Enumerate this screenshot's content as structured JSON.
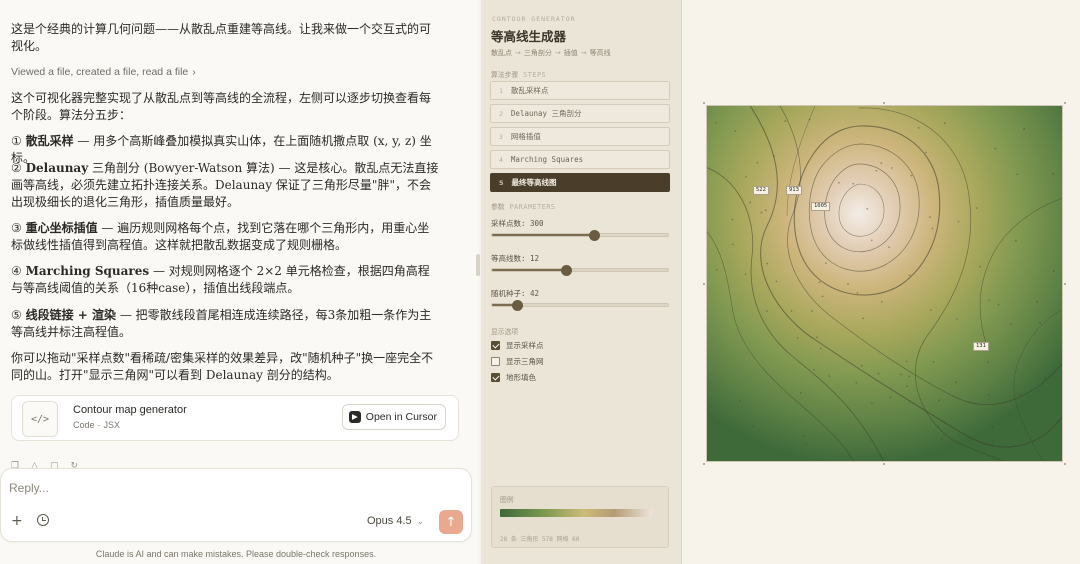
{
  "chat": {
    "intro": "这是个经典的计算几何问题——从散乱点重建等高线。让我来做一个交互式的可视化。",
    "tool_line": "Viewed a file, created a file, read a file",
    "summary": "这个可视化器完整实现了从散乱点到等高线的全流程，左侧可以逐步切换查看每个阶段。算法分五步：",
    "steps": [
      {
        "marker": "①",
        "title": "散乱采样",
        "sep": " — ",
        "body": "用多个高斯峰叠加模拟真实山体，在上面随机撒点取 (x, y, z) 坐标。"
      },
      {
        "marker": "②",
        "title": "Delaunay",
        "title_tail": " 三角剖分 (Bowyer-Watson 算法)",
        "sep": " — ",
        "body": "这是核心。散乱点无法直接画等高线，必须先建立拓扑连接关系。Delaunay 保证了三角形尽量\"胖\"，不会出现极细长的退化三角形，插值质量最好。"
      },
      {
        "marker": "③",
        "title": "重心坐标插值",
        "sep": " — ",
        "body": "遍历规则网格每个点，找到它落在哪个三角形内，用重心坐标做线性插值得到高程值。这样就把散乱数据变成了规则栅格。"
      },
      {
        "marker": "④",
        "title": "Marching Squares",
        "sep": " — ",
        "body": "对规则网格逐个 2×2 单元格检查，根据四角高程与等高线阈值的关系（16种case），插值出线段端点。"
      },
      {
        "marker": "⑤",
        "title": "线段链接 + 渲染",
        "sep": " — ",
        "body": "把零散线段首尾相连成连续路径，每3条加粗一条作为主等高线并标注高程值。"
      }
    ],
    "closing": "你可以拖动\"采样点数\"看稀疏/密集采样的效果差异，改\"随机种子\"换一座完全不同的山。打开\"显示三角网\"可以看到 Delaunay 剖分的结构。",
    "artifact": {
      "title": "Contour map generator",
      "type": "Code",
      "lang": "JSX",
      "open_label": "Open in Cursor"
    },
    "composer": {
      "placeholder": "Reply...",
      "model": "Opus 4.5"
    },
    "disclaimer": "Claude is AI and can make mistakes. Please double-check responses."
  },
  "sidebar": {
    "subtitle": "CONTOUR GENERATOR",
    "title": "等高线生成器",
    "breadcrumb": [
      "散乱点",
      "三角剖分",
      "插值",
      "等高线"
    ],
    "steps_section": {
      "label": "算法步骤",
      "label_en": "STEPS"
    },
    "steps": [
      {
        "num": "1",
        "label": "散乱采样点"
      },
      {
        "num": "2",
        "label": "Delaunay 三角剖分"
      },
      {
        "num": "3",
        "label": "网格插值"
      },
      {
        "num": "4",
        "label": "Marching Squares"
      },
      {
        "num": "5",
        "label": "最终等高线图",
        "active": true
      }
    ],
    "params_section": {
      "label": "参数",
      "label_en": "PARAMETERS"
    },
    "sliders": [
      {
        "label": "采样点数",
        "value": "300",
        "fraction": 0.58
      },
      {
        "label": "等高线数",
        "value": "12",
        "fraction": 0.42
      },
      {
        "label": "随机种子",
        "value": "42",
        "fraction": 0.14
      }
    ],
    "display_section": {
      "label": "显示选项"
    },
    "checks": [
      {
        "label": "显示采样点",
        "checked": true
      },
      {
        "label": "显示三角网",
        "checked": false
      },
      {
        "label": "地形填色",
        "checked": true
      }
    ],
    "legend": {
      "title": "图例",
      "stats": "28 条  三角形 578  网格 60"
    }
  },
  "map": {
    "labels": [
      "522",
      "913",
      "1005",
      "131"
    ],
    "colors": {
      "low": "#3e6a3a",
      "mid": "#a8a85c",
      "tan": "#cdb57c",
      "high": "#f3ede6",
      "accent": "#e8a98f"
    }
  }
}
